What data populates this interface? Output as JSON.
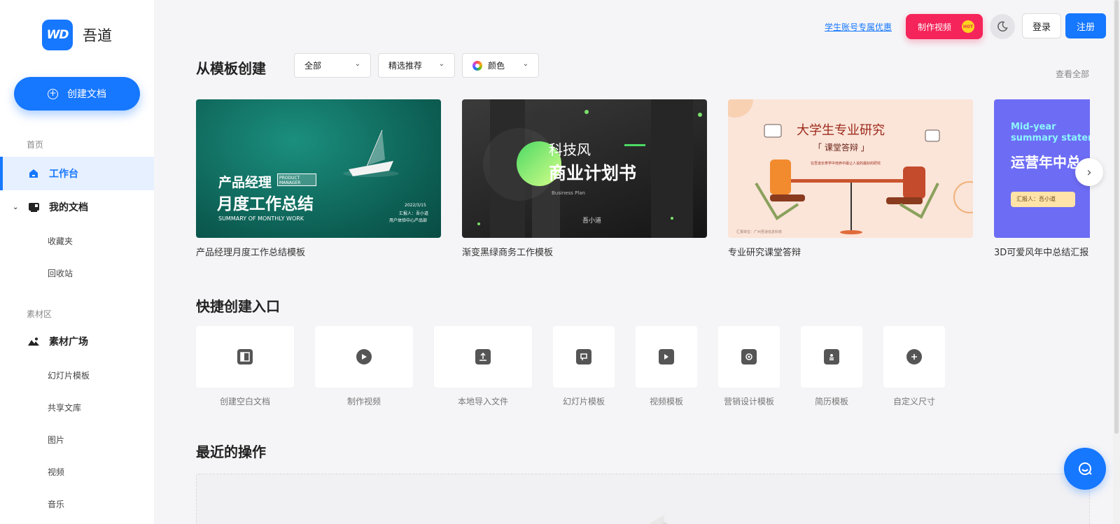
{
  "brand": {
    "logo_mark": "WD",
    "name": "吾道"
  },
  "sidebar": {
    "create_label": "创建文档",
    "section_home": "首页",
    "workbench": "工作台",
    "my_docs": "我的文档",
    "favorites": "收藏夹",
    "recycle": "回收站",
    "section_assets": "素材区",
    "asset_square": "素材广场",
    "slide_templates": "幻灯片模板",
    "shared_library": "共享文库",
    "images": "图片",
    "videos": "视频",
    "music": "音乐"
  },
  "topbar": {
    "student_link": "学生账号专属优惠",
    "make_video": "制作视频",
    "hot_badge": "HOT",
    "login": "登录",
    "signup": "注册"
  },
  "templates": {
    "title": "从模板创建",
    "filter_all": "全部",
    "filter_recommend": "精选推荐",
    "filter_color": "颜色",
    "view_all": "查看全部",
    "cards": [
      {
        "label": "产品经理月度工作总结模板",
        "thumb_title_1": "产品经理",
        "thumb_tag": "PRODUCT MANAGER",
        "thumb_title_2": "月度工作总结",
        "thumb_sub": "SUMMARY OF MONTHLY WORK",
        "thumb_date": "2022/3/15",
        "thumb_reporter": "汇报人：吾小道",
        "thumb_dept": "用户体验中心产品部"
      },
      {
        "label": "渐变黑绿商务工作模板",
        "thumb_title_1": "科技风",
        "thumb_title_2": "商业计划书",
        "thumb_sub": "Business Plan",
        "thumb_author": "吾小道"
      },
      {
        "label": "专业研究课堂答辩",
        "thumb_title_1": "大学生专业研究",
        "thumb_title_2": "「 课堂答辩 」",
        "thumb_sub": "在吾道长寿学中培养中最让人说的最好的研究",
        "thumb_foot": "汇报单位：广州吾道信息科技"
      },
      {
        "label": "3D可爱风年中总结汇报",
        "thumb_title_1": "Mid-year",
        "thumb_title_2": "summary statement",
        "thumb_title_3": "运营年中总",
        "thumb_reporter": "汇报人：吾小道"
      }
    ]
  },
  "quick": {
    "title": "快捷创建入口",
    "items": [
      {
        "label": "创建空白文档",
        "icon": "blank-doc-icon"
      },
      {
        "label": "制作视频",
        "icon": "play-icon"
      },
      {
        "label": "本地导入文件",
        "icon": "upload-icon"
      },
      {
        "label": "幻灯片模板",
        "icon": "slide-icon"
      },
      {
        "label": "视频模板",
        "icon": "video-template-icon"
      },
      {
        "label": "营销设计模板",
        "icon": "marketing-icon"
      },
      {
        "label": "简历模板",
        "icon": "resume-icon"
      },
      {
        "label": "自定义尺寸",
        "icon": "plus-icon"
      }
    ]
  },
  "recent": {
    "title": "最近的操作"
  },
  "colors": {
    "accent": "#1677ff",
    "hot": "#f5245a"
  }
}
